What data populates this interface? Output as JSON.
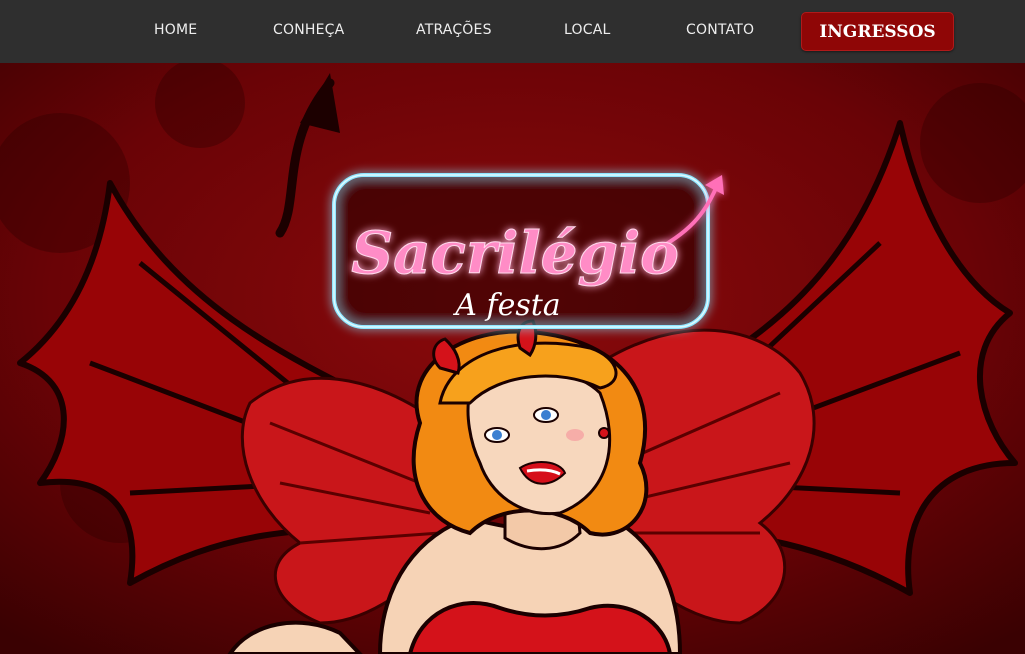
{
  "nav": {
    "items": [
      {
        "label": "HOME"
      },
      {
        "label": "CONHEÇA"
      },
      {
        "label": "ATRAÇÕES"
      },
      {
        "label": "LOCAL"
      },
      {
        "label": "CONTATO"
      }
    ],
    "cta_label": "INGRESSOS"
  },
  "hero": {
    "logo_title": "Sacrilégio",
    "logo_subtitle": "A festa",
    "background_icon": "devil-wings-illustration",
    "character_icon": "pinup-devil-woman-illustration"
  },
  "colors": {
    "nav_bg": "#2f2f2f",
    "cta_bg": "#8f0606",
    "hero_bg": "#6d0305",
    "neon_pink": "#ff6fb8",
    "neon_blue": "#8fe6ff"
  }
}
